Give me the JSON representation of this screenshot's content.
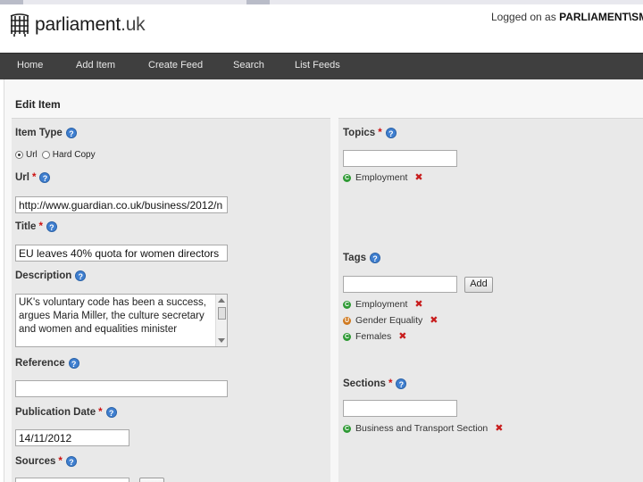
{
  "header": {
    "logo_text": "parliament",
    "logo_suffix": ".uk",
    "login_prefix": "Logged on as ",
    "login_user": "PARLIAMENT\\SMITH"
  },
  "nav": {
    "items": [
      "Home",
      "Add Item",
      "Create Feed",
      "Search",
      "List Feeds"
    ]
  },
  "page_title": "Edit Item",
  "form": {
    "item_type": {
      "label": "Item Type",
      "options": [
        "Url",
        "Hard Copy"
      ],
      "selected": "Url"
    },
    "url": {
      "label": "Url",
      "required_mark": "*",
      "value": "http://www.guardian.co.uk/business/2012/n"
    },
    "title": {
      "label": "Title",
      "required_mark": "*",
      "value": "EU leaves 40% quota for women directors"
    },
    "description": {
      "label": "Description",
      "value": "UK's voluntary code has been a success, argues Maria Miller, the culture secretary and women and equalities minister"
    },
    "reference": {
      "label": "Reference",
      "value": ""
    },
    "publication_date": {
      "label": "Publication Date",
      "required_mark": "*",
      "value": "14/11/2012"
    },
    "sources": {
      "label": "Sources",
      "required_mark": "*"
    }
  },
  "topics": {
    "label": "Topics",
    "required_mark": "*",
    "input_value": "",
    "items": [
      {
        "badge": "C",
        "text": "Employment",
        "badge_color": "#2f9a35"
      }
    ]
  },
  "tags": {
    "label": "Tags",
    "input_value": "",
    "add_label": "Add",
    "items": [
      {
        "badge": "C",
        "text": "Employment",
        "badge_color": "#2f9a35"
      },
      {
        "badge": "U",
        "text": "Gender Equality",
        "badge_color": "#d07a20"
      },
      {
        "badge": "C",
        "text": "Females",
        "badge_color": "#2f9a35"
      }
    ]
  },
  "sections": {
    "label": "Sections",
    "required_mark": "*",
    "input_value": "",
    "items": [
      {
        "badge": "C",
        "text": "Business and Transport Section",
        "badge_color": "#2f9a35"
      }
    ]
  },
  "icons": {
    "help": "?",
    "remove": "✖"
  },
  "colors": {
    "navbar": "#3f3f3f",
    "required": "#cc1111",
    "help_icon": "#3f7fd0",
    "remove_icon": "#c81d1d"
  }
}
